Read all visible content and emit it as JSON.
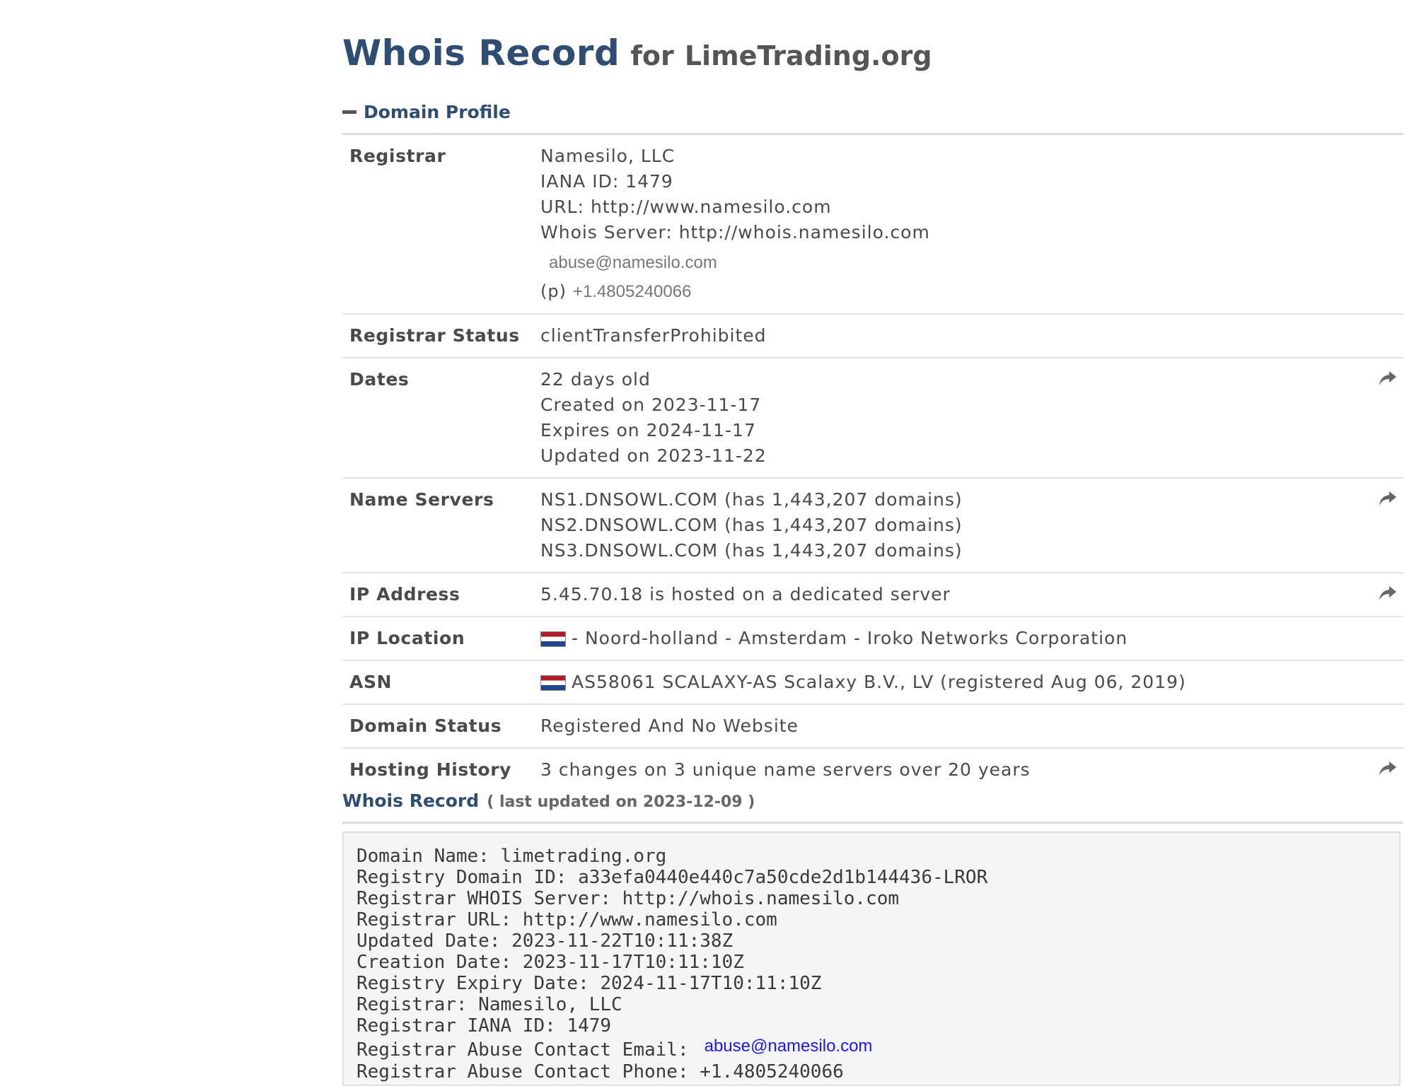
{
  "header": {
    "title": "Whois Record",
    "for_text": "for",
    "domain": "LimeTrading.org"
  },
  "profile": {
    "section_label": "Domain Profile",
    "registrar": {
      "label": "Registrar",
      "name": "Namesilo, LLC",
      "iana": "IANA ID: 1479",
      "url": "URL: http://www.namesilo.com",
      "whois_server": "Whois Server: http://whois.namesilo.com",
      "email": "abuse@namesilo.com",
      "phone_prefix": "(p)",
      "phone": "+1.4805240066"
    },
    "registrar_status": {
      "label": "Registrar Status",
      "value": "clientTransferProhibited"
    },
    "dates": {
      "label": "Dates",
      "age": "22 days old",
      "created": "Created on 2023-11-17",
      "expires": "Expires on 2024-11-17",
      "updated": "Updated on 2023-11-22"
    },
    "name_servers": {
      "label": "Name Servers",
      "items": [
        "NS1.DNSOWL.COM (has 1,443,207 domains)",
        "NS2.DNSOWL.COM (has 1,443,207 domains)",
        "NS3.DNSOWL.COM (has 1,443,207 domains)"
      ]
    },
    "ip_address": {
      "label": "IP Address",
      "value": "5.45.70.18 is hosted on a dedicated server"
    },
    "ip_location": {
      "label": "IP Location",
      "value": "- Noord-holland - Amsterdam - Iroko Networks Corporation"
    },
    "asn": {
      "label": "ASN",
      "value": "AS58061 SCALAXY-AS Scalaxy B.V., LV (registered Aug 06, 2019)"
    },
    "domain_status": {
      "label": "Domain Status",
      "value": "Registered And No Website"
    },
    "hosting_history": {
      "label": "Hosting History",
      "value": "3 changes on 3 unique name servers over 20 years"
    }
  },
  "whois_record": {
    "title": "Whois Record",
    "updated_note": "( last updated on 2023-12-09 )",
    "lines": [
      "Domain Name: limetrading.org",
      "Registry Domain ID: a33efa0440e440c7a50cde2d1b144436-LROR",
      "Registrar WHOIS Server: http://whois.namesilo.com",
      "Registrar URL: http://www.namesilo.com",
      "Updated Date: 2023-11-22T10:11:38Z",
      "Creation Date: 2023-11-17T10:11:10Z",
      "Registry Expiry Date: 2024-11-17T10:11:10Z",
      "Registrar: Namesilo, LLC",
      "Registrar IANA ID: 1479"
    ],
    "abuse_email_label": "Registrar Abuse Contact Email:",
    "abuse_email": "abuse@namesilo.com",
    "abuse_phone_line": "Registrar Abuse Contact Phone: +1.4805240066"
  },
  "icons": {
    "share": "share-arrow-icon",
    "collapse": "minus-icon",
    "flag": "netherlands-flag-icon"
  },
  "colors": {
    "heading_blue": "#2f4d73",
    "text_gray": "#4a4a4a",
    "link_blue": "#1a1aee"
  }
}
